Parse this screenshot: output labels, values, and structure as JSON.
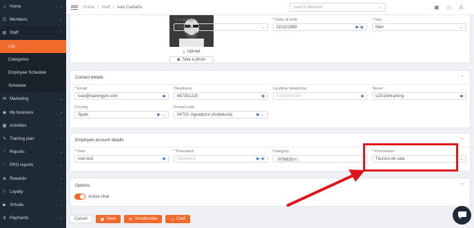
{
  "sidebar": {
    "items": [
      {
        "label": "Home",
        "icon": "home-icon",
        "glyph": "⌂"
      },
      {
        "label": "Members",
        "icon": "members-icon",
        "glyph": "☷"
      },
      {
        "label": "Staff",
        "icon": "staff-icon",
        "glyph": "▤"
      }
    ],
    "staff_sub": [
      {
        "label": "List",
        "active": true
      },
      {
        "label": "Categories"
      },
      {
        "label": "Employee Schedule"
      },
      {
        "label": "Schedule"
      }
    ],
    "rest": [
      {
        "label": "Marketing",
        "icon": "marketing-icon",
        "glyph": "✉"
      },
      {
        "label": "My business",
        "icon": "business-icon",
        "glyph": "◉"
      },
      {
        "label": "Activities",
        "icon": "activities-icon",
        "glyph": "▦"
      },
      {
        "label": "Training plan",
        "icon": "training-icon",
        "glyph": "✎"
      },
      {
        "label": "Reports",
        "icon": "reports-icon",
        "glyph": "⟋"
      },
      {
        "label": "PRO reports",
        "icon": "pro-reports-icon",
        "glyph": "⟋"
      },
      {
        "label": "Rewards",
        "icon": "rewards-icon",
        "glyph": "♛"
      },
      {
        "label": "Loyalty",
        "icon": "loyalty-icon",
        "glyph": "⚐"
      },
      {
        "label": "Virtuals",
        "icon": "virtuals-icon",
        "glyph": "▶"
      },
      {
        "label": "Payments",
        "icon": "payments-icon",
        "glyph": "$"
      }
    ]
  },
  "topbar": {
    "breadcrumb": [
      "Home",
      "Staff",
      "Ivan Castaño"
    ],
    "search_placeholder": "Search Member"
  },
  "profile": {
    "upload_label": "Upload",
    "take_photo_label": "Take a photo",
    "language": {
      "label": "Language",
      "value": "Spanish"
    },
    "dob": {
      "label": "Date of birth",
      "value": "22/12/1980"
    },
    "sex": {
      "label": "Sex",
      "value": "Man"
    }
  },
  "contact": {
    "title": "Contact details",
    "email": {
      "label": "Email",
      "value": "ivan@trainingym.com"
    },
    "telephone": {
      "label": "Telephone",
      "value": "667351225"
    },
    "landline": {
      "label": "Landline telephone",
      "placeholder": "XXXXXXXXX"
    },
    "street": {
      "label": "Street",
      "value": "c/2016#training"
    },
    "country": {
      "label": "Country",
      "value": "Spain"
    },
    "postal": {
      "label": "Postal code",
      "value": "04720, Aguadulce (Andalucía)"
    }
  },
  "account": {
    "title": "Employee account details",
    "user": {
      "label": "User",
      "value": "ivan.test"
    },
    "password": {
      "label": "Password",
      "placeholder": "Password"
    },
    "category": {
      "label": "Category",
      "chip": "FITNESS"
    },
    "permission": {
      "label": "Permission",
      "value": "Técnico de sala"
    }
  },
  "options": {
    "title": "Options",
    "active_chat_label": "Active chat",
    "active_chat": true
  },
  "actions": {
    "cancel": "Cancel",
    "save": "Save",
    "unsubscribe": "Unsubscribe",
    "card": "Card"
  },
  "colors": {
    "accent": "#f26a2b",
    "sidebar": "#1e2a35",
    "annotation": "#e0151b"
  }
}
